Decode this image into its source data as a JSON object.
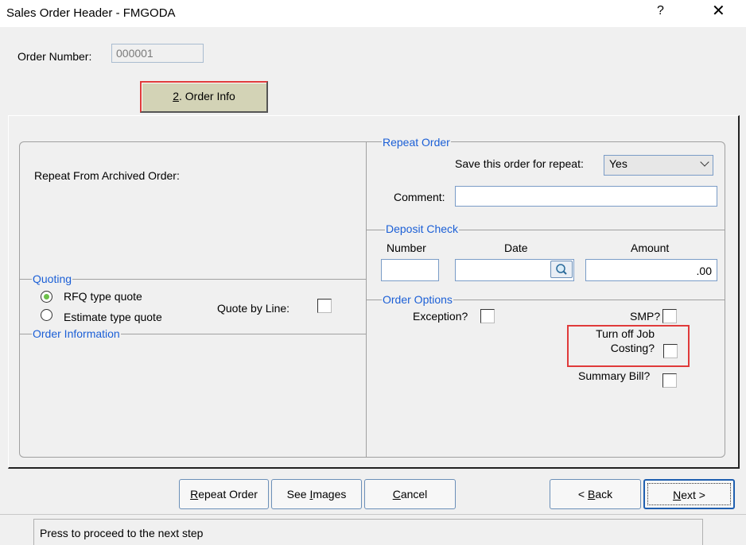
{
  "window": {
    "title": "Sales Order Header - FMGODA",
    "help": "?",
    "close": "✕"
  },
  "order_number": {
    "label": "Order Number:",
    "value": "000001"
  },
  "tab_button": {
    "prefix": "2",
    "rest": ". Order Info"
  },
  "left_panel": {
    "repeat_from_archived": "Repeat From Archived Order:"
  },
  "quoting": {
    "title": "Quoting",
    "options": [
      {
        "label": "RFQ type quote",
        "selected": true
      },
      {
        "label": "Estimate type quote",
        "selected": false
      }
    ],
    "quote_by_line": "Quote by Line:"
  },
  "order_information": {
    "title": "Order Information"
  },
  "repeat_order": {
    "title": "Repeat Order",
    "save_label": "Save this order for repeat:",
    "save_value": "Yes",
    "comment_label": "Comment:",
    "comment_value": ""
  },
  "deposit_check": {
    "title": "Deposit Check",
    "number_label": "Number",
    "date_label": "Date",
    "amount_label": "Amount",
    "number_value": "",
    "date_value": "",
    "amount_value": ".00"
  },
  "order_options": {
    "title": "Order Options",
    "exception": "Exception?",
    "smp": "SMP?",
    "turn_off_line1": "Turn off Job",
    "turn_off_line2": "Costing?",
    "summary_bill": "Summary Bill?"
  },
  "buttons": {
    "repeat_order": {
      "u": "R",
      "rest": "epeat Order"
    },
    "see_images": {
      "pre": "See ",
      "u": "I",
      "rest": "mages"
    },
    "cancel": {
      "u": "C",
      "rest": "ancel"
    },
    "back": {
      "pre": "< ",
      "u": "B",
      "rest": "ack"
    },
    "next": {
      "u": "N",
      "rest": "ext >"
    }
  },
  "status": {
    "text": "Press to proceed to the next step"
  },
  "colors": {
    "accent": "#1b5fd6",
    "highlight": "#e03a3a",
    "tab_bg": "#d3d3b6"
  },
  "icons": {
    "search": "magnifier-icon",
    "close": "close-icon"
  }
}
